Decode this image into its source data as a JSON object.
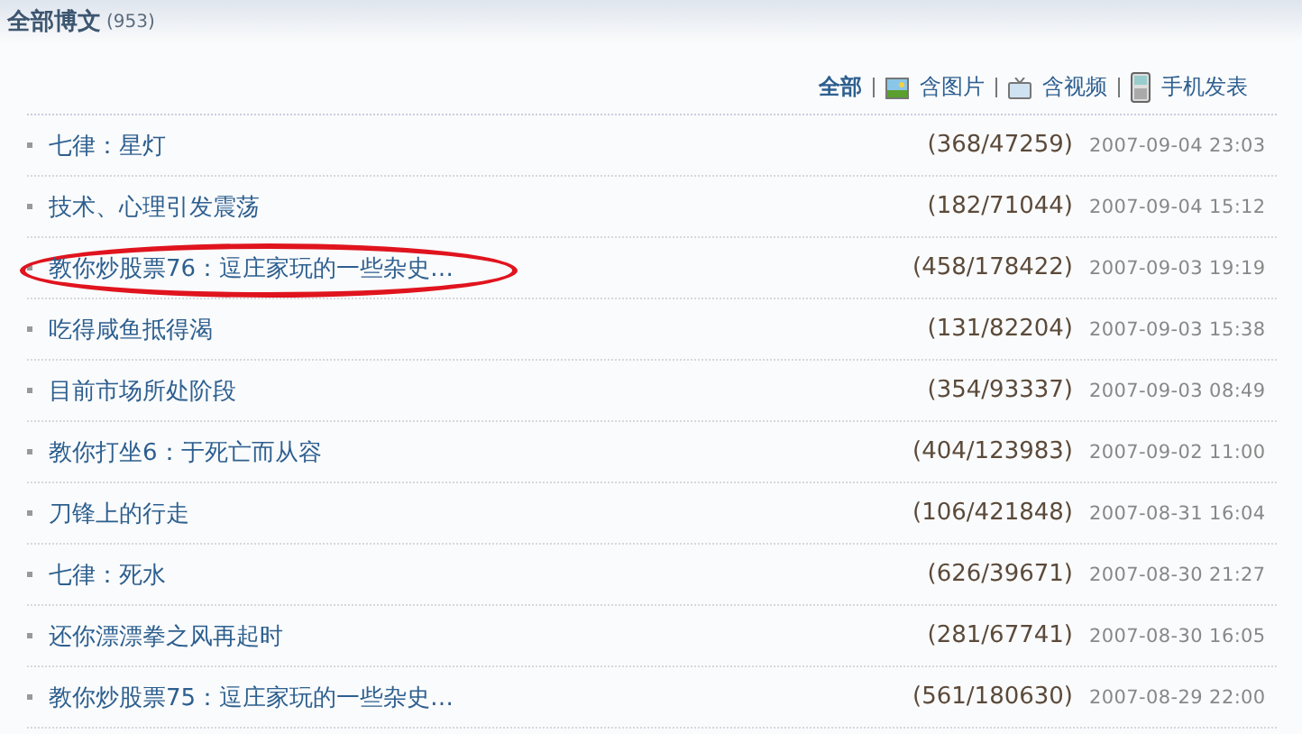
{
  "header": {
    "title": "全部博文",
    "count": "(953)"
  },
  "filters": [
    {
      "label": "全部",
      "kind": "all",
      "selected": true
    },
    {
      "label": "含图片",
      "kind": "image",
      "selected": false
    },
    {
      "label": "含视频",
      "kind": "video",
      "selected": false
    },
    {
      "label": "手机发表",
      "kind": "phone",
      "selected": false
    }
  ],
  "posts": [
    {
      "title": "七律：星灯",
      "stats": "(368/47259)",
      "date": "2007-09-04 23:03",
      "circled": false
    },
    {
      "title": "技术、心理引发震荡",
      "stats": "(182/71044)",
      "date": "2007-09-04 15:12",
      "circled": false
    },
    {
      "title": "教你炒股票76：逗庄家玩的一些杂史…",
      "stats": "(458/178422)",
      "date": "2007-09-03 19:19",
      "circled": true
    },
    {
      "title": "吃得咸鱼抵得渴",
      "stats": "(131/82204)",
      "date": "2007-09-03 15:38",
      "circled": false
    },
    {
      "title": "目前市场所处阶段",
      "stats": "(354/93337)",
      "date": "2007-09-03 08:49",
      "circled": false
    },
    {
      "title": "教你打坐6：于死亡而从容",
      "stats": "(404/123983)",
      "date": "2007-09-02 11:00",
      "circled": false
    },
    {
      "title": "刀锋上的行走",
      "stats": "(106/421848)",
      "date": "2007-08-31 16:04",
      "circled": false
    },
    {
      "title": "七律：死水",
      "stats": "(626/39671)",
      "date": "2007-08-30 21:27",
      "circled": false
    },
    {
      "title": "还你漂漂拳之风再起时",
      "stats": "(281/67741)",
      "date": "2007-08-30 16:05",
      "circled": false
    },
    {
      "title": "教你炒股票75：逗庄家玩的一些杂史…",
      "stats": "(561/180630)",
      "date": "2007-08-29 22:00",
      "circled": false
    }
  ]
}
